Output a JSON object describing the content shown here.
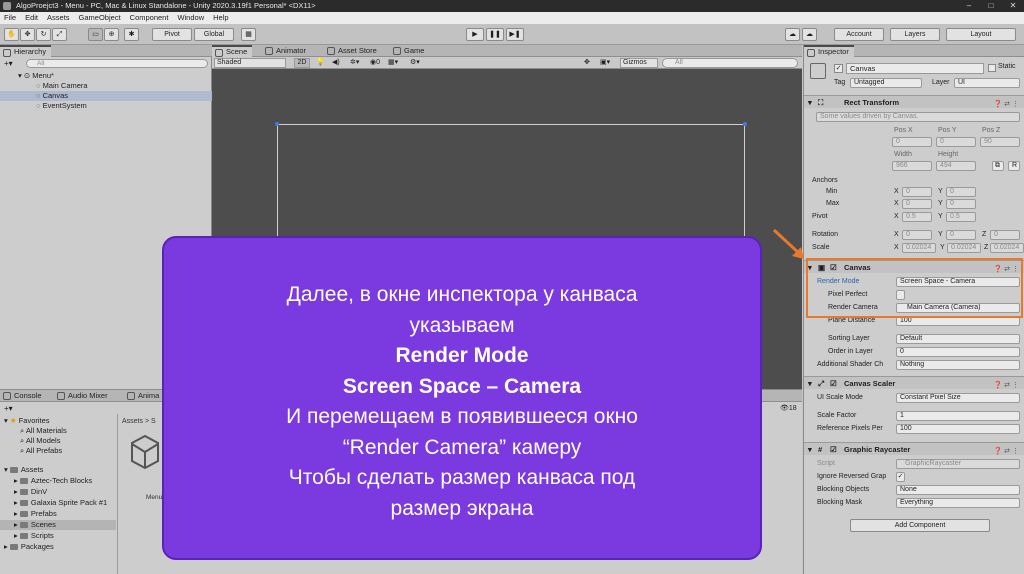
{
  "window": {
    "title": "AlgoProejct3 - Menu - PC, Mac & Linux Standalone - Unity 2020.3.19f1 Personal* <DX11>"
  },
  "menubar": [
    "File",
    "Edit",
    "Assets",
    "GameObject",
    "Component",
    "Window",
    "Help"
  ],
  "toolbar": {
    "pivot": "Pivot",
    "global": "Global",
    "account": "Account",
    "layers": "Layers",
    "layout": "Layout"
  },
  "hierarchy": {
    "tab": "Hierarchy",
    "search_placeholder": "All",
    "scene_name": "Menu*",
    "items": [
      "Main Camera",
      "Canvas",
      "EventSystem"
    ]
  },
  "scene": {
    "tabs": [
      "Scene",
      "Animator",
      "Asset Store",
      "Game"
    ],
    "shading": "Shaded",
    "mode": "2D",
    "gizmos": "Gizmos",
    "search_placeholder": "All"
  },
  "bottom": {
    "tabs": [
      "Console",
      "Audio Mixer",
      "Anima"
    ],
    "breadcrumb": "Assets > S",
    "slider_count": "18",
    "asset_label": "Menu",
    "favorites": "Favorites",
    "favorite_items": [
      "All Materials",
      "All Models",
      "All Prefabs"
    ],
    "assets": "Assets",
    "asset_folders": [
      "Aztec-Tech Blocks",
      "DinV",
      "Galaxia Sprite Pack #1",
      "Prefabs",
      "Scenes",
      "Scripts"
    ],
    "packages": "Packages"
  },
  "inspector": {
    "tab": "Inspector",
    "object_name": "Canvas",
    "static_label": "Static",
    "tag_label": "Tag",
    "tag_value": "Untagged",
    "layer_label": "Layer",
    "layer_value": "UI",
    "rect_transform": {
      "title": "Rect Transform",
      "note": "Some values driven by Canvas.",
      "pos_x_label": "Pos X",
      "pos_y_label": "Pos Y",
      "pos_z_label": "Pos Z",
      "pos_x": "0",
      "pos_y": "0",
      "pos_z": "90",
      "width_label": "Width",
      "height_label": "Height",
      "width": "966",
      "height": "494",
      "anchors": "Anchors",
      "min": "Min",
      "max": "Max",
      "min_x": "0",
      "min_y": "0",
      "max_x": "0",
      "max_y": "0",
      "pivot": "Pivot",
      "pivot_x": "0.5",
      "pivot_y": "0.5",
      "rotation": "Rotation",
      "rot_x": "0",
      "rot_y": "0",
      "rot_z": "0",
      "scale": "Scale",
      "scale_x": "0.02024",
      "scale_y": "0.02024",
      "scale_z": "0.02024",
      "x": "X",
      "y": "Y",
      "z": "Z",
      "r": "R"
    },
    "canvas": {
      "title": "Canvas",
      "render_mode_label": "Render Mode",
      "render_mode": "Screen Space - Camera",
      "pixel_perfect_label": "Pixel Perfect",
      "render_camera_label": "Render Camera",
      "render_camera": "Main Camera (Camera)",
      "plane_distance_label": "Plane Distance",
      "plane_distance": "100",
      "sorting_layer_label": "Sorting Layer",
      "sorting_layer": "Default",
      "order_label": "Order in Layer",
      "order": "0",
      "shader_label": "Additional Shader Ch",
      "shader": "Nothing"
    },
    "canvas_scaler": {
      "title": "Canvas Scaler",
      "scale_mode_label": "UI Scale Mode",
      "scale_mode": "Constant Pixel Size",
      "scale_factor_label": "Scale Factor",
      "scale_factor": "1",
      "ref_ppu_label": "Reference Pixels Per",
      "ref_ppu": "100"
    },
    "graphic_raycaster": {
      "title": "Graphic Raycaster",
      "script_label": "Script",
      "script": "GraphicRaycaster",
      "ignore_label": "Ignore Reversed Grap",
      "blocking_objects_label": "Blocking Objects",
      "blocking_objects": "None",
      "blocking_mask_label": "Blocking Mask",
      "blocking_mask": "Everything"
    },
    "add_component": "Add Component"
  },
  "overlay": {
    "lines": [
      "Далее, в окне инспектора у канваса",
      "указываем",
      "Render Mode",
      "Screen Space – Camera",
      "И перемещаем в появившееся окно",
      "“Render Camera” камеру",
      "Чтобы сделать размер канваса под",
      "размер экрана"
    ]
  },
  "colors": {
    "overlay": "#7b39e0",
    "highlight": "#e8782a"
  }
}
